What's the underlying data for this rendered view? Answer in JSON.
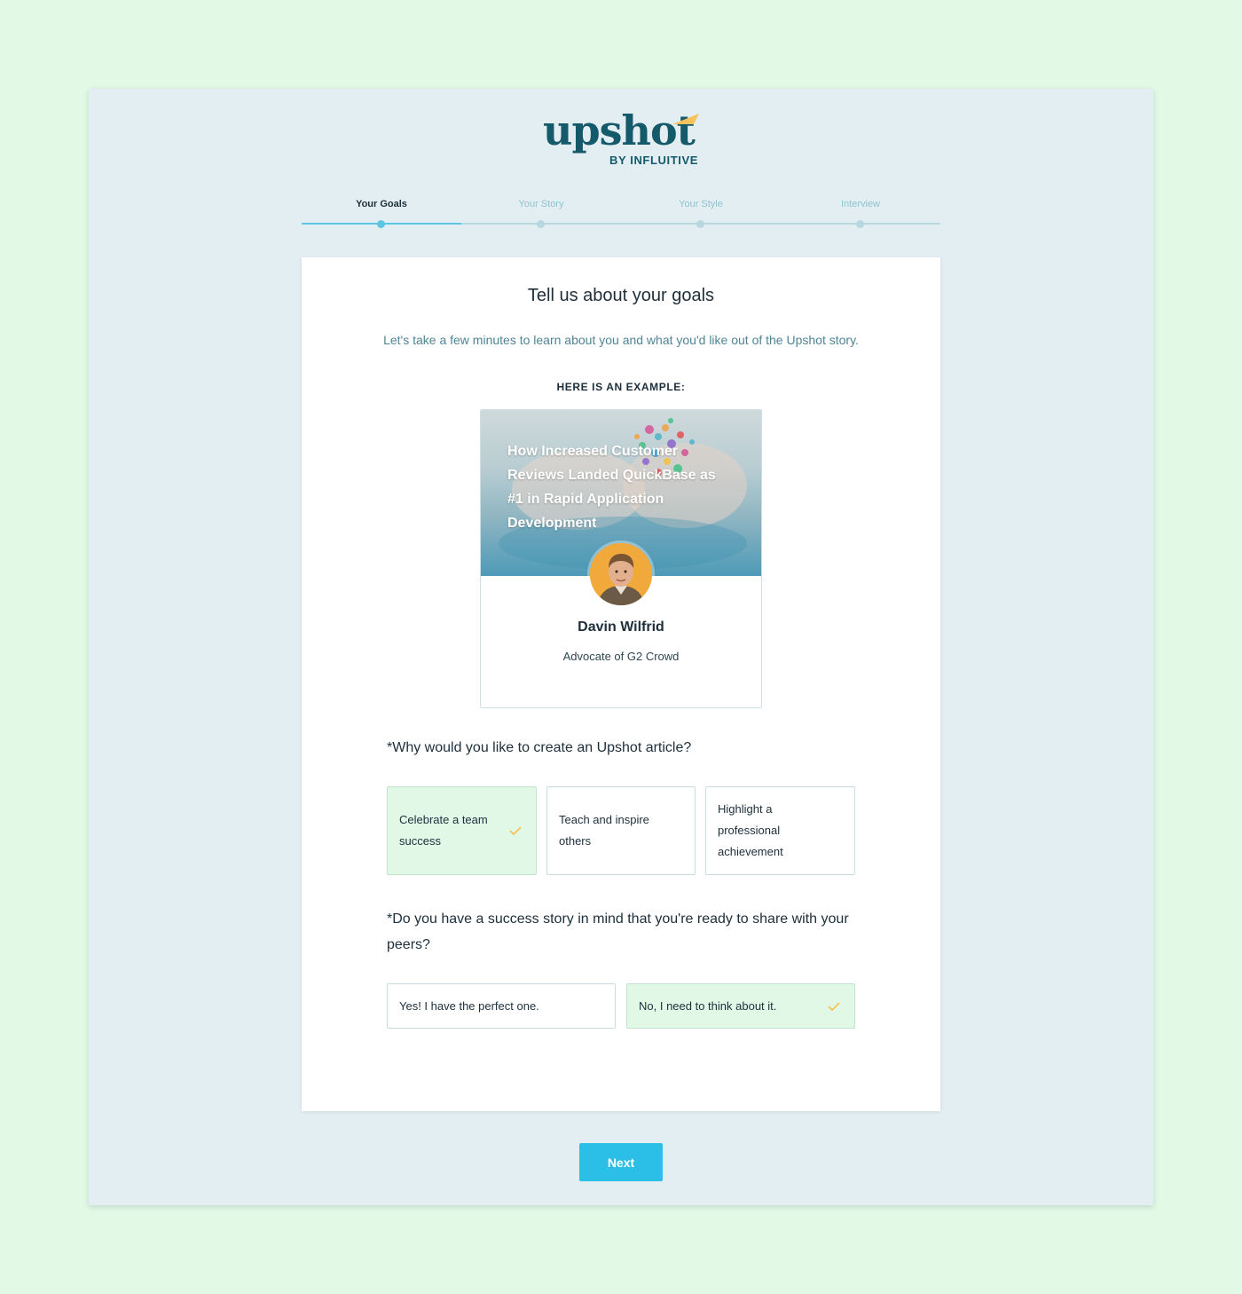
{
  "brand": {
    "logo_word": "upshot",
    "logo_sub": "BY INFLUITIVE",
    "colors": {
      "primary": "#155a6a",
      "accent": "#f6c35b"
    }
  },
  "stepper": {
    "steps": [
      {
        "label": "Your Goals",
        "active": true
      },
      {
        "label": "Your Story",
        "active": false
      },
      {
        "label": "Your Style",
        "active": false
      },
      {
        "label": "Interview",
        "active": false
      }
    ],
    "progress_color": "#5cc6e3"
  },
  "card": {
    "title": "Tell us about your goals",
    "subtitle": "Let's take a few minutes to learn about you and what you'd like out of the Upshot story.",
    "example_label": "HERE IS AN EXAMPLE:",
    "example": {
      "headline": "How Increased Customer Reviews Landed QuickBase as #1 in Rapid Application Development",
      "author_name": "Davin Wilfrid",
      "author_role": "Advocate of G2 Crowd"
    }
  },
  "questions": {
    "q1": {
      "text": "*Why would you like to create an Upshot article?",
      "options": [
        {
          "label": "Celebrate a team success",
          "selected": true
        },
        {
          "label": "Teach and inspire others",
          "selected": false
        },
        {
          "label": "Highlight a professional achievement",
          "selected": false
        }
      ]
    },
    "q2": {
      "text": "*Do you have a success story in mind that you're ready to share with your peers?",
      "options": [
        {
          "label": "Yes! I have the perfect one.",
          "selected": false
        },
        {
          "label": "No, I need to think about it.",
          "selected": true
        }
      ]
    }
  },
  "actions": {
    "next_label": "Next",
    "button_color": "#2bbfe8",
    "check_color": "#f6c35b",
    "selected_bg": "#e2f8e6"
  }
}
